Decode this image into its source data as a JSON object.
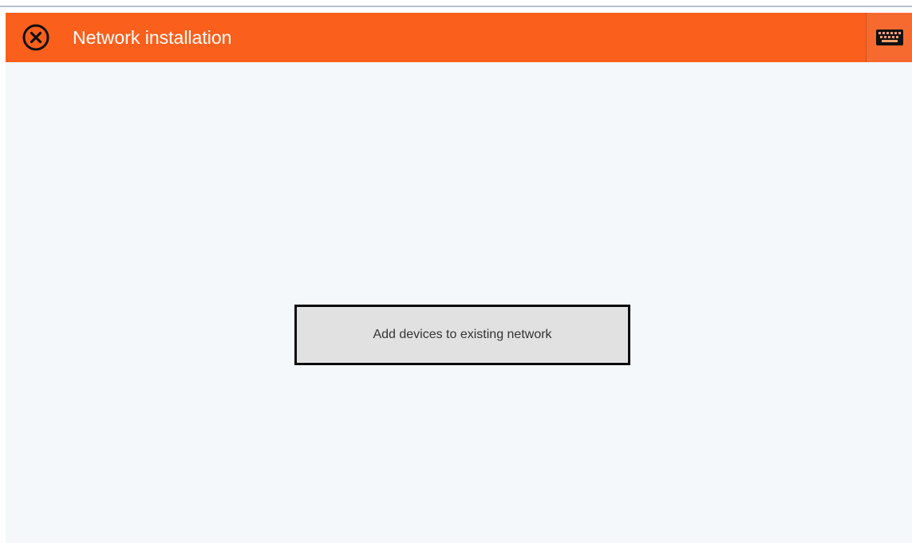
{
  "header": {
    "title": "Network installation",
    "close_icon": "close-circle-icon",
    "keyboard_icon": "keyboard-icon",
    "background_color": "#fb5f1c"
  },
  "main": {
    "action_button_label": "Add devices to existing network"
  }
}
